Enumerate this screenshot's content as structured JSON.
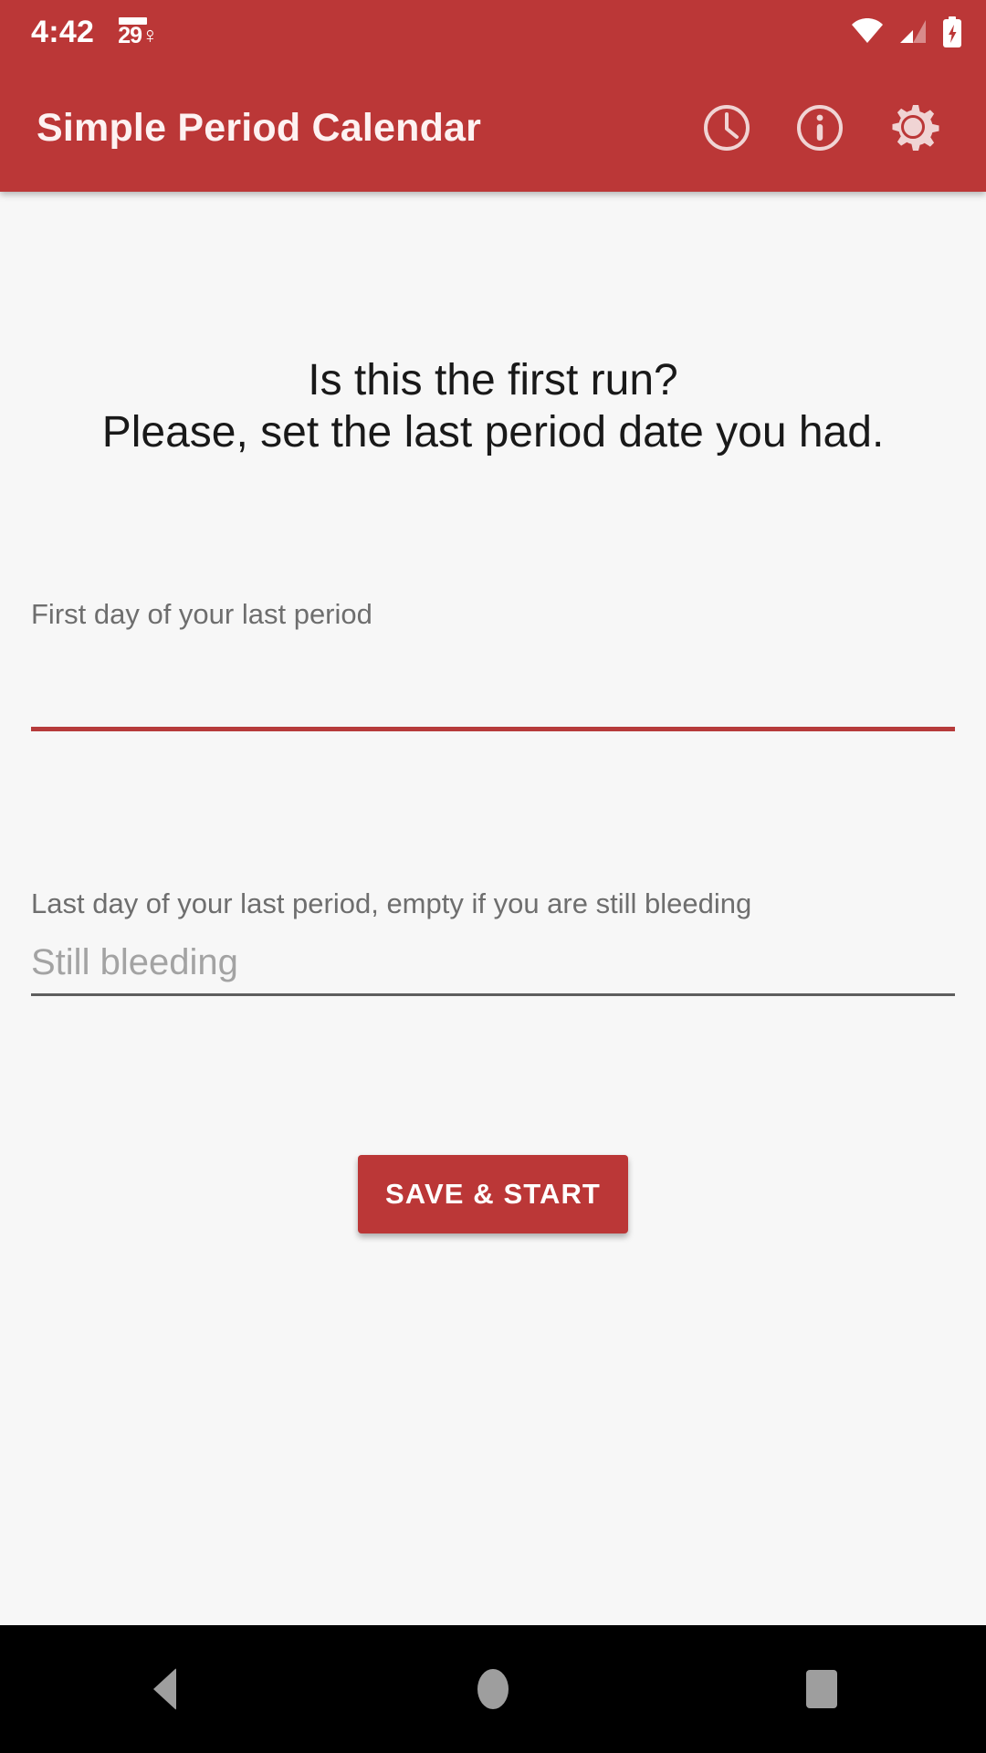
{
  "status_bar": {
    "time": "4:42",
    "notification_icon": "period-day-count-notification-icon",
    "notification_text": "29♀",
    "icons": [
      "wifi-icon",
      "cellular-signal-icon",
      "battery-charging-icon"
    ],
    "background_color": "#bb3737"
  },
  "app_bar": {
    "title": "Simple Period Calendar",
    "background_color": "#bb3737",
    "title_color": "#fdf2f2",
    "actions": [
      {
        "name": "history-clock-button",
        "icon": "clock-icon"
      },
      {
        "name": "info-button",
        "icon": "info-circle-icon"
      },
      {
        "name": "settings-button",
        "icon": "gear-icon"
      }
    ]
  },
  "main": {
    "headline_line1": "Is this the first run?",
    "headline_line2": "Please, set the last period date you had.",
    "first_day_field": {
      "label": "First day of your last period",
      "value": "",
      "placeholder": "",
      "underline_color": "#b63b3b",
      "focused": true
    },
    "last_day_field": {
      "label": "Last day of your last period, empty if you are still bleeding",
      "value": "",
      "placeholder": "Still bleeding",
      "underline_color": "#5e5e5e",
      "focused": false
    },
    "save_button_label": "SAVE & START",
    "save_button_color": "#bb3737",
    "background_color": "#f7f7f7"
  },
  "nav_bar": {
    "background_color": "#000000",
    "buttons": [
      {
        "name": "back-button",
        "icon": "triangle-back-icon"
      },
      {
        "name": "home-button",
        "icon": "circle-home-icon"
      },
      {
        "name": "recents-button",
        "icon": "square-recents-icon"
      }
    ]
  }
}
